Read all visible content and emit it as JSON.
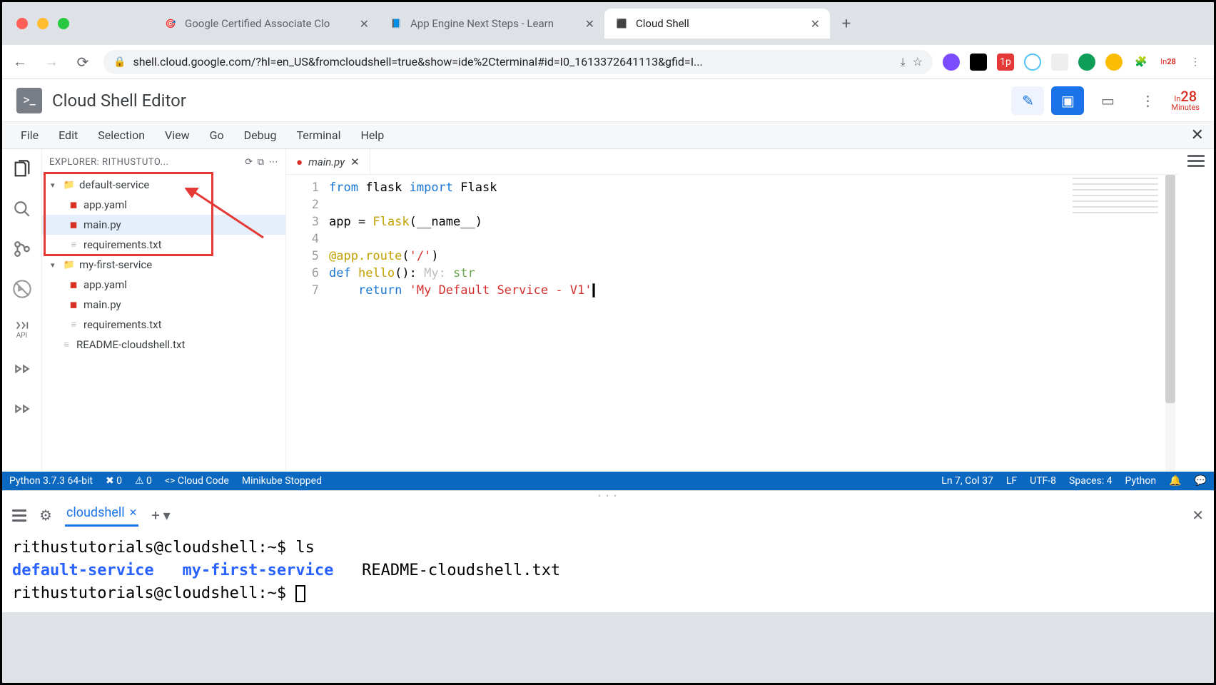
{
  "browser": {
    "tabs": [
      {
        "title": "Google Certified Associate Clo"
      },
      {
        "title": "App Engine Next Steps - Learn"
      },
      {
        "title": "Cloud Shell"
      }
    ],
    "url": "shell.cloud.google.com/?hl=en_US&fromcloudshell=true&show=ide%2Cterminal#id=I0_1613372641113&gfid=I..."
  },
  "app": {
    "title": "Cloud Shell Editor",
    "timer_value": "28",
    "timer_unit": "Minutes",
    "timer_prefix": "In"
  },
  "menu": {
    "items": [
      "File",
      "Edit",
      "Selection",
      "View",
      "Go",
      "Debug",
      "Terminal",
      "Help"
    ]
  },
  "explorer": {
    "header": "EXPLORER: RITHUSTUTO...",
    "tree": {
      "default_service": "default-service",
      "ds_app": "app.yaml",
      "ds_main": "main.py",
      "ds_req": "requirements.txt",
      "my_first_service": "my-first-service",
      "mf_app": "app.yaml",
      "mf_main": "main.py",
      "mf_req": "requirements.txt",
      "readme": "README-cloudshell.txt"
    }
  },
  "editor": {
    "tabname": "main.py",
    "code_line1_a": "from",
    "code_line1_b": " flask ",
    "code_line1_c": "import",
    "code_line1_d": " Flask",
    "code_line3_a": "app = ",
    "code_line3_b": "Flask",
    "code_line3_c": "(__name__)",
    "code_line5": "@app.route",
    "code_line5_b": "(",
    "code_line5_c": "'/'",
    "code_line5_d": ")",
    "code_line6_a": "def ",
    "code_line6_b": "hello",
    "code_line6_c": "(): ",
    "code_line6_hint1": "My: ",
    "code_line6_hint2": "str",
    "code_line7_a": "    ",
    "code_line7_b": "return",
    "code_line7_c": " ",
    "code_line7_d": "'My Default Service - V1'"
  },
  "status": {
    "python": "Python 3.7.3 64-bit",
    "err": "✖ 0",
    "warn": "⚠ 0",
    "cloudcode": "<> Cloud Code",
    "minikube": "Minikube Stopped",
    "ln": "Ln 7, Col 37",
    "lf": "LF",
    "enc": "UTF-8",
    "spaces": "Spaces: 4",
    "lang": "Python"
  },
  "terminal": {
    "tabname": "cloudshell",
    "line1_prompt": "rithustutorials@cloudshell",
    "line1_path": ":~$ ",
    "line1_cmd": "ls",
    "line2_a": "default-service",
    "line2_b": "my-first-service",
    "line2_c": "README-cloudshell.txt",
    "line3_prompt": "rithustutorials@cloudshell",
    "line3_path": ":~$ "
  }
}
